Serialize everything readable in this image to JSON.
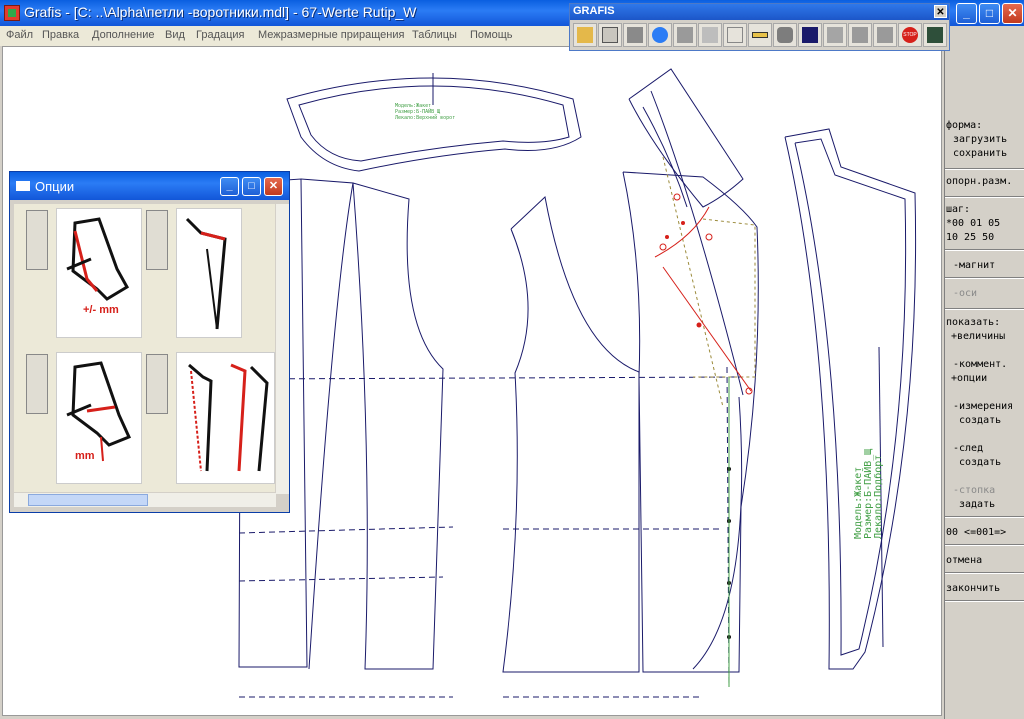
{
  "window": {
    "title": "Grafis - [C: ..\\Alpha\\петли -воротники.mdl] - 67-Werte Rutip_W",
    "minimize": "_",
    "maximize": "□",
    "close": "✕"
  },
  "menu": [
    "Файл",
    "Правка",
    "Дополнение",
    "Вид",
    "Градация",
    "Межразмерные приращения",
    "Таблицы",
    "Помощь"
  ],
  "toolbar": {
    "title": "GRAFIS",
    "close": "✕",
    "buttons": [
      "open-folder-icon",
      "open-file-icon",
      "save-icon",
      "zoom-icon",
      "print-icon",
      "page-setup-icon",
      "layers-icon",
      "ruler-icon",
      "grading-icon",
      "delete-icon",
      "edit-icon",
      "download-icon",
      "import-icon",
      "stop-icon",
      "calculator-icon"
    ],
    "stop_label": "STOP"
  },
  "options_window": {
    "title": "Опции",
    "minimize": "_",
    "maximize": "□",
    "close": "✕",
    "labels": {
      "pm": "+/- mm",
      "mm": "mm"
    }
  },
  "right_panel": {
    "forma": "форма:",
    "load": "загрузить",
    "save": "сохранить",
    "opor": "опорн.разм.",
    "step": "шаг:",
    "step_row1": "*00  01  05",
    "step_row2": " 10  25  50",
    "magnet": "-магнит",
    "axes": "-оси",
    "show": "показать:",
    "values": "+величины",
    "comment": "-коммент.",
    "options": "+опции",
    "measure": "-измерения",
    "measure_create": "создать",
    "trace": "-след",
    "trace_create": "создать",
    "stack": "-стопка",
    "stack_set": "задать",
    "counter": "00 <=001=>",
    "cancel": "отмена",
    "finish": "закончить"
  },
  "canvas_text": {
    "collar_label": [
      "Модель:Жакет",
      "Размер:Б-ПАЙВ_Щ",
      "Лекало:Верхний ворот"
    ],
    "vertical_label": [
      "Модель:Жакет",
      "Размер:Б-ПАЙВ_Щ",
      "Лекало:Подборт"
    ]
  },
  "colors": {
    "title_blue": "#1256d8",
    "pattern_line": "#1a1a6a",
    "accent_red": "#d6201a",
    "label_green": "#43a047"
  }
}
